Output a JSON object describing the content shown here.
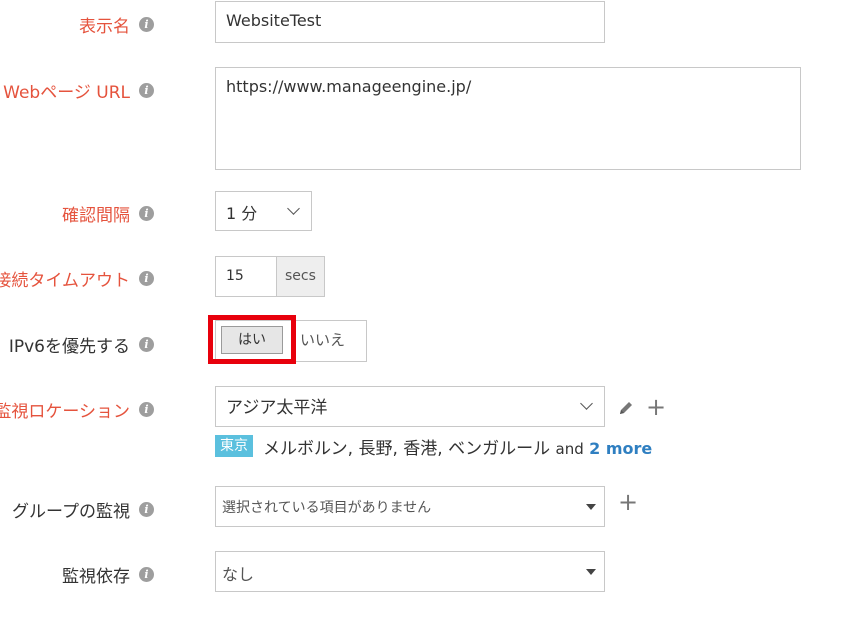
{
  "display_name": {
    "label": "表示名",
    "value": "WebsiteTest"
  },
  "web_url": {
    "label": "Webページ URL",
    "value": "https://www.manageengine.jp/"
  },
  "check_interval": {
    "label": "確認間隔",
    "value": "1 分"
  },
  "connection_timeout": {
    "label": "接続タイムアウト",
    "value": "15",
    "unit": "secs"
  },
  "prefer_ipv6": {
    "label": "IPv6を優先する",
    "yes": "はい",
    "no": "いいえ",
    "selected": "はい",
    "highlight_color": "#e8000c"
  },
  "monitor_location": {
    "label": "監視ロケーション",
    "value": "アジア太平洋",
    "tag": "東京",
    "locations": "メルボルン, 長野, 香港, ベンガルール",
    "and_text": "and",
    "more_text": "2 more",
    "tag_color": "#5bc0de",
    "link_color": "#2f7fc1"
  },
  "monitor_group": {
    "label": "グループの監視",
    "placeholder": "選択されている項目がありません"
  },
  "monitor_dependency": {
    "label": "監視依存",
    "value": "なし"
  },
  "colors": {
    "required_label": "#e5533d",
    "info_icon": "#9e9e9e"
  },
  "icons": [
    "info-icon",
    "chevron-down-icon",
    "pencil-icon",
    "plus-icon",
    "dropdown-triangle-icon"
  ]
}
